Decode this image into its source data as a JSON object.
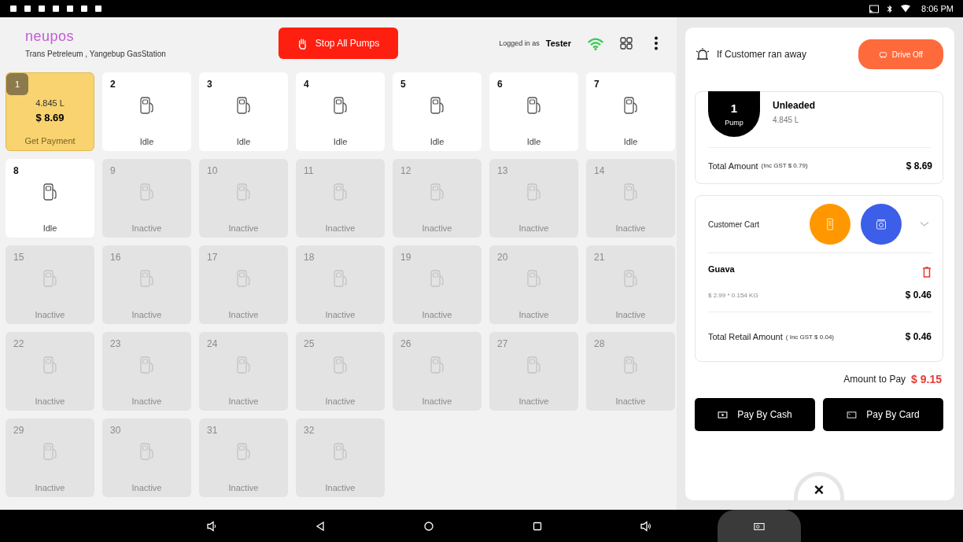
{
  "status_bar": {
    "time": "8:06 PM"
  },
  "header": {
    "logo": "neupos",
    "station": "Trans Petreleum , Yangebup GasStation",
    "stop_button": "Stop All Pumps",
    "logged_in_label": "Logged in as",
    "user": "Tester"
  },
  "pumps": [
    {
      "number": "1",
      "kind": "payment",
      "volume": "4.845 L",
      "amount": "$ 8.69",
      "status": "Get Payment"
    },
    {
      "number": "2",
      "kind": "idle",
      "status": "Idle"
    },
    {
      "number": "3",
      "kind": "idle",
      "status": "Idle"
    },
    {
      "number": "4",
      "kind": "idle",
      "status": "Idle"
    },
    {
      "number": "5",
      "kind": "idle",
      "status": "Idle"
    },
    {
      "number": "6",
      "kind": "idle",
      "status": "Idle"
    },
    {
      "number": "7",
      "kind": "idle",
      "status": "Idle"
    },
    {
      "number": "8",
      "kind": "idle",
      "status": "Idle"
    },
    {
      "number": "9",
      "kind": "inactive",
      "status": "Inactive"
    },
    {
      "number": "10",
      "kind": "inactive",
      "status": "Inactive"
    },
    {
      "number": "11",
      "kind": "inactive",
      "status": "Inactive"
    },
    {
      "number": "12",
      "kind": "inactive",
      "status": "Inactive"
    },
    {
      "number": "13",
      "kind": "inactive",
      "status": "Inactive"
    },
    {
      "number": "14",
      "kind": "inactive",
      "status": "Inactive"
    },
    {
      "number": "15",
      "kind": "inactive",
      "status": "Inactive"
    },
    {
      "number": "16",
      "kind": "inactive",
      "status": "Inactive"
    },
    {
      "number": "17",
      "kind": "inactive",
      "status": "Inactive"
    },
    {
      "number": "18",
      "kind": "inactive",
      "status": "Inactive"
    },
    {
      "number": "19",
      "kind": "inactive",
      "status": "Inactive"
    },
    {
      "number": "20",
      "kind": "inactive",
      "status": "Inactive"
    },
    {
      "number": "21",
      "kind": "inactive",
      "status": "Inactive"
    },
    {
      "number": "22",
      "kind": "inactive",
      "status": "Inactive"
    },
    {
      "number": "23",
      "kind": "inactive",
      "status": "Inactive"
    },
    {
      "number": "24",
      "kind": "inactive",
      "status": "Inactive"
    },
    {
      "number": "25",
      "kind": "inactive",
      "status": "Inactive"
    },
    {
      "number": "26",
      "kind": "inactive",
      "status": "Inactive"
    },
    {
      "number": "27",
      "kind": "inactive",
      "status": "Inactive"
    },
    {
      "number": "28",
      "kind": "inactive",
      "status": "Inactive"
    },
    {
      "number": "29",
      "kind": "inactive",
      "status": "Inactive"
    },
    {
      "number": "30",
      "kind": "inactive",
      "status": "Inactive"
    },
    {
      "number": "31",
      "kind": "inactive",
      "status": "Inactive"
    },
    {
      "number": "32",
      "kind": "inactive",
      "status": "Inactive"
    }
  ],
  "panel": {
    "drive_off": {
      "label": "If Customer ran away",
      "button": "Drive Off"
    },
    "fuel": {
      "pump_number": "1",
      "pump_label": "Pump",
      "product": "Unleaded",
      "volume": "4.845 L",
      "total_label": "Total Amount",
      "total_gst": "(Inc GST $ 0.79)",
      "total": "$ 8.69"
    },
    "cart": {
      "title": "Customer Cart",
      "items": [
        {
          "name": "Guava",
          "detail": "$ 2.99  * 0.154 KG",
          "price": "$ 0.46"
        }
      ],
      "retail_label": "Total Retail Amount",
      "retail_gst": "( Inc GST $ 0.04)",
      "retail_total": "$ 0.46"
    },
    "amount_label": "Amount to Pay",
    "amount": "$ 9.15",
    "buttons": [
      {
        "kind": "cash",
        "label": "Pay By Cash"
      },
      {
        "kind": "card",
        "label": "Pay By Card"
      }
    ],
    "close": "×"
  }
}
